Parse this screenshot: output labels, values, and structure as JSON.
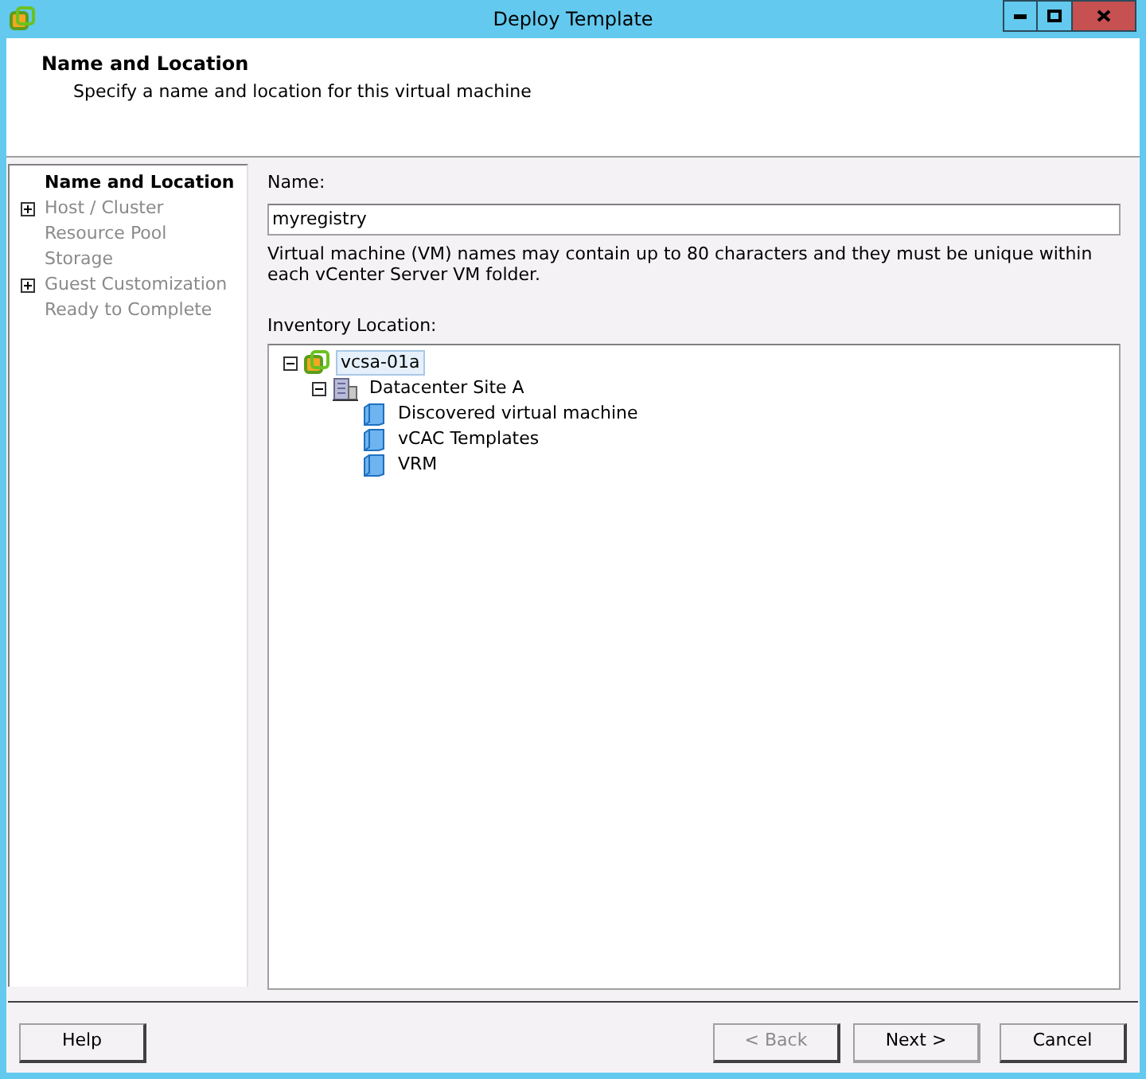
{
  "window": {
    "title": "Deploy Template"
  },
  "header": {
    "title": "Name and Location",
    "subtitle": "Specify a name and location for this virtual machine"
  },
  "steps": [
    {
      "label": "Name and Location",
      "selected": true,
      "expandable": false
    },
    {
      "label": "Host / Cluster",
      "selected": false,
      "expandable": true
    },
    {
      "label": "Resource Pool",
      "selected": false,
      "expandable": false
    },
    {
      "label": "Storage",
      "selected": false,
      "expandable": false
    },
    {
      "label": "Guest Customization",
      "selected": false,
      "expandable": true
    },
    {
      "label": "Ready to Complete",
      "selected": false,
      "expandable": false
    }
  ],
  "name_field": {
    "label": "Name:",
    "value": "myregistry"
  },
  "hint": "Virtual machine (VM) names may contain up to 80 characters and they must be unique within each vCenter Server VM folder.",
  "inventory": {
    "label": "Inventory Location:",
    "tree": [
      {
        "kind": "vcenter",
        "label": "vcsa-01a",
        "selected": true,
        "expanded": true,
        "children": [
          {
            "kind": "datacenter",
            "label": "Datacenter Site A",
            "selected": false,
            "expanded": true,
            "children": [
              {
                "kind": "folder",
                "label": "Discovered virtual machine",
                "selected": false
              },
              {
                "kind": "folder",
                "label": "vCAC Templates",
                "selected": false
              },
              {
                "kind": "folder",
                "label": "VRM",
                "selected": false
              }
            ]
          }
        ]
      }
    ]
  },
  "buttons": [
    {
      "label": "Help",
      "disabled": false,
      "default": false
    },
    {
      "label": "< Back",
      "disabled": true,
      "default": false
    },
    {
      "label": "Next >",
      "disabled": false,
      "default": true
    },
    {
      "label": "Cancel",
      "disabled": false,
      "default": false
    }
  ]
}
